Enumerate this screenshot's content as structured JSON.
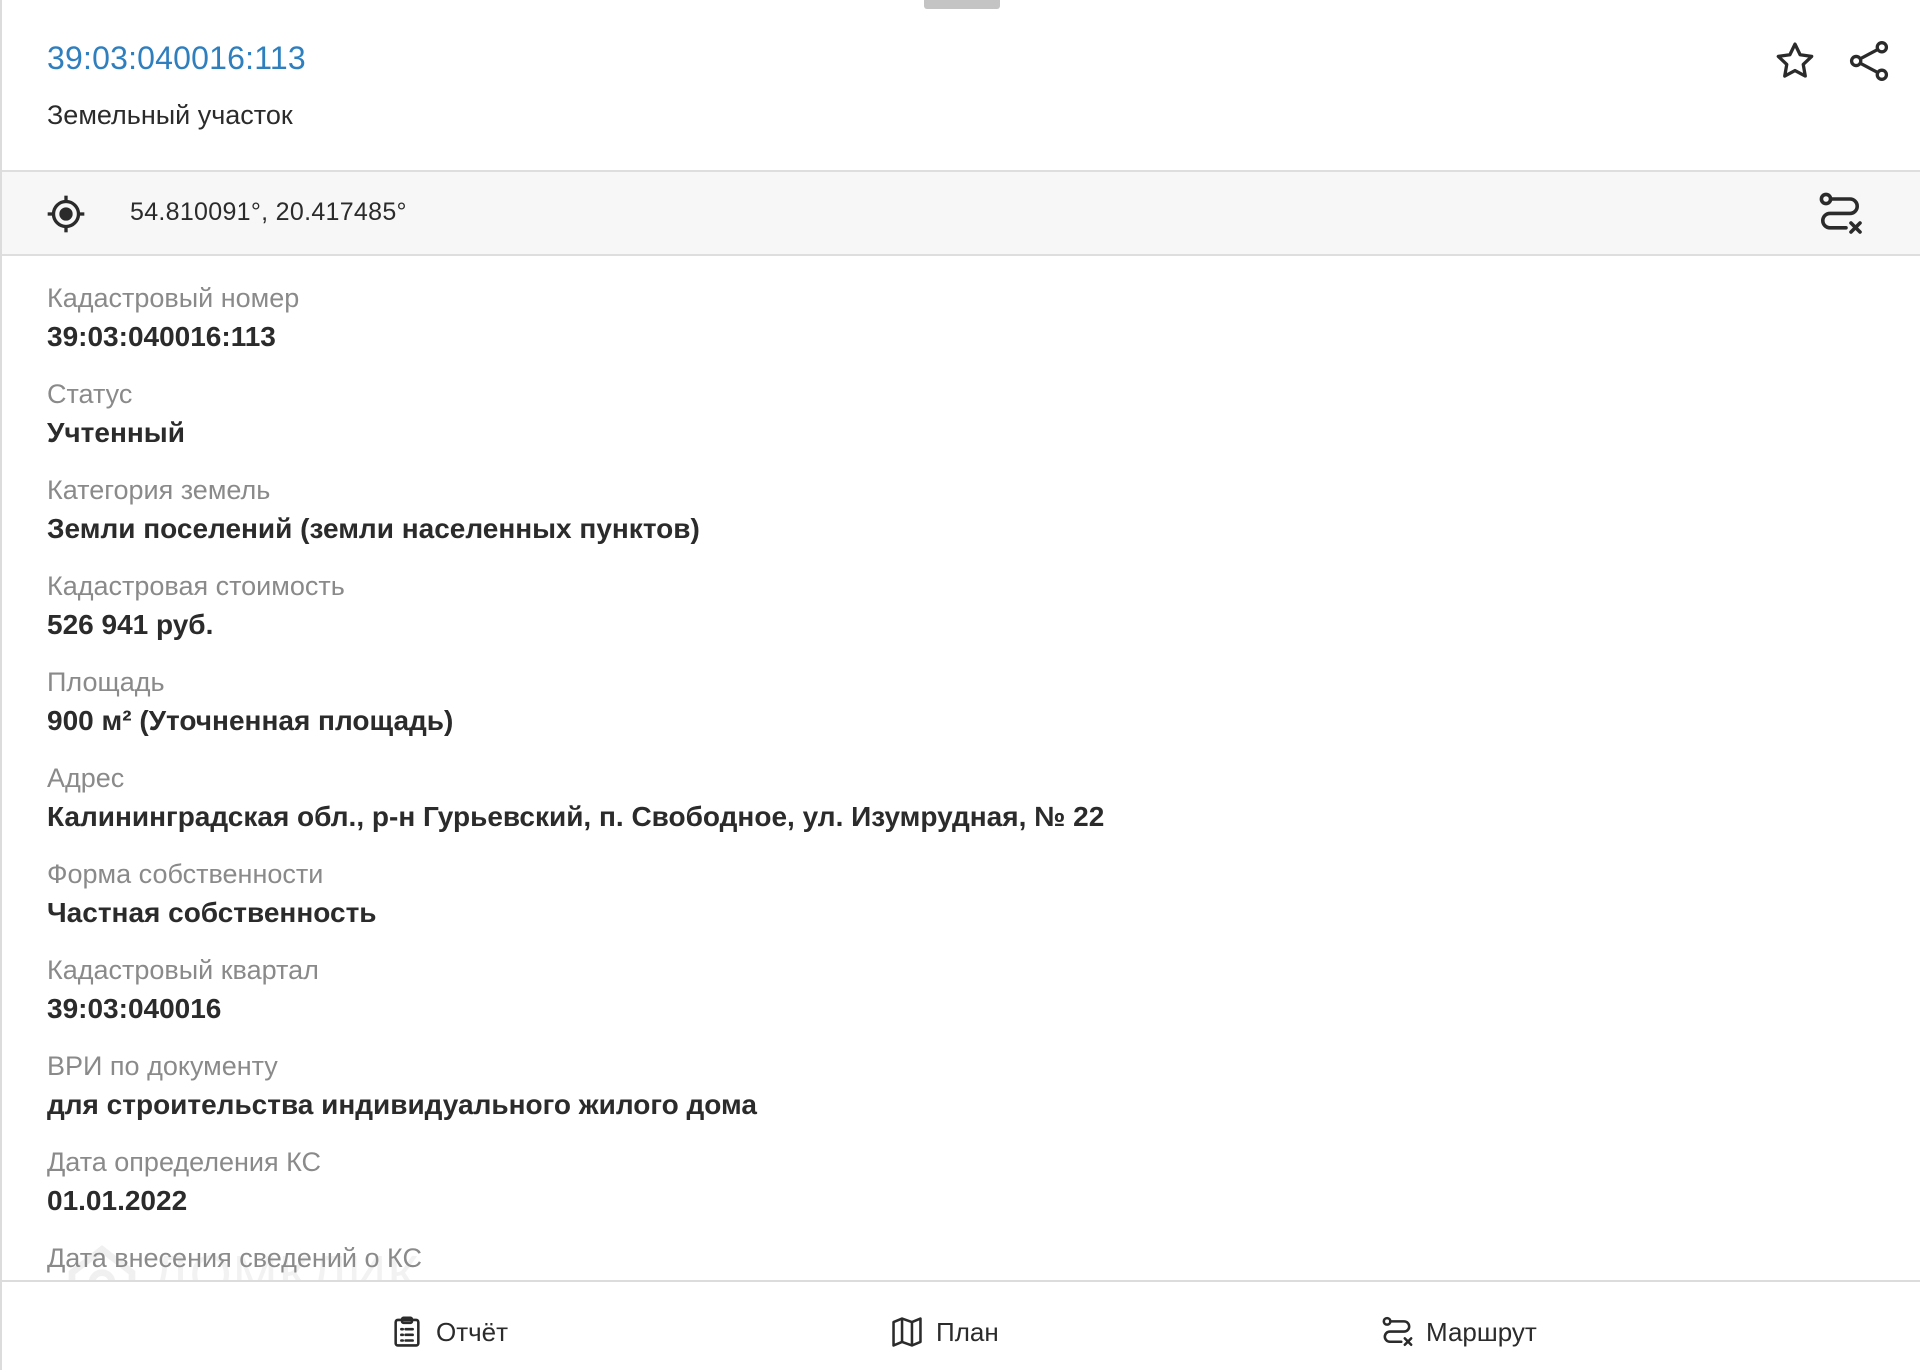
{
  "header": {
    "title": "39:03:040016:113",
    "subtitle": "Земельный участок",
    "actions": [
      {
        "icon": "star-icon"
      },
      {
        "icon": "share-icon"
      }
    ]
  },
  "coordinates": {
    "text": "54.810091°, 20.417485°",
    "icon": "locate-icon",
    "route_icon": "route-icon"
  },
  "details": [
    {
      "label": "Кадастровый номер",
      "value": "39:03:040016:113"
    },
    {
      "label": "Статус",
      "value": "Учтенный"
    },
    {
      "label": "Категория земель",
      "value": "Земли поселений (земли населенных пунктов)"
    },
    {
      "label": "Кадастровая стоимость",
      "value": "526 941 руб."
    },
    {
      "label": "Площадь",
      "value": "900 м² (Уточненная площадь)"
    },
    {
      "label": "Адрес",
      "value": "Калининградская обл., р-н Гурьевский, п. Свободное, ул. Изумрудная, № 22"
    },
    {
      "label": "Форма собственности",
      "value": "Частная собственность"
    },
    {
      "label": "Кадастровый квартал",
      "value": "39:03:040016"
    },
    {
      "label": "ВРИ по документу",
      "value": "для строительства индивидуального жилого дома"
    },
    {
      "label": "Дата определения КС",
      "value": "01.01.2022"
    },
    {
      "label": "Дата внесения сведений о КС",
      "value": ""
    }
  ],
  "watermark": {
    "text": "ДОМКЛИК"
  },
  "bottom_bar": {
    "report_label": "Отчёт",
    "plan_label": "План",
    "route_label": "Маршрут"
  },
  "colors": {
    "link": "#2f7fbf",
    "label": "#8a8a8a",
    "text": "#2b2b2b"
  }
}
